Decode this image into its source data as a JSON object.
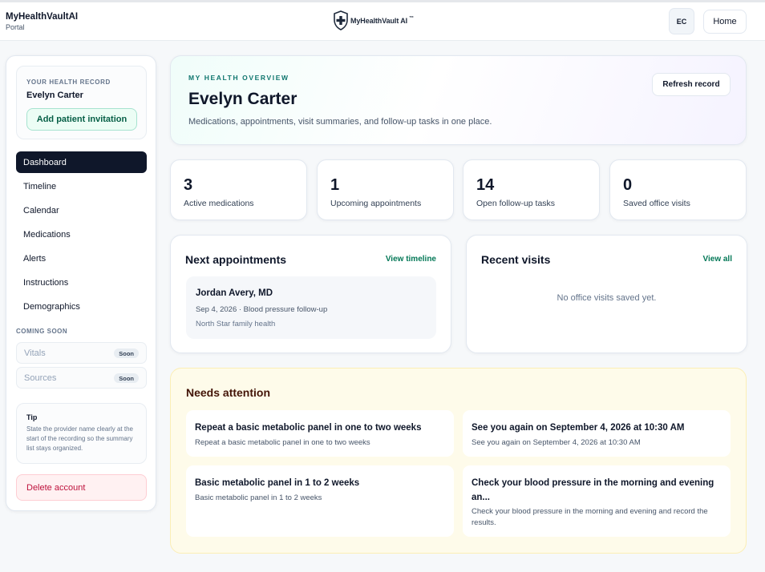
{
  "header": {
    "brand_name": "MyHealthVaultAI",
    "brand_sub": "Portal",
    "logo_text": "MyHealthVault AI",
    "logo_tm": "™",
    "avatar_initials": "EC",
    "home_label": "Home"
  },
  "sidebar": {
    "record_eyebrow": "YOUR HEALTH RECORD",
    "record_name": "Evelyn Carter",
    "invite_label": "Add patient invitation",
    "nav": [
      {
        "label": "Dashboard",
        "active": true
      },
      {
        "label": "Timeline",
        "active": false
      },
      {
        "label": "Calendar",
        "active": false
      },
      {
        "label": "Medications",
        "active": false
      },
      {
        "label": "Alerts",
        "active": false
      },
      {
        "label": "Instructions",
        "active": false
      },
      {
        "label": "Demographics",
        "active": false
      }
    ],
    "coming_soon_label": "COMING SOON",
    "coming_soon": [
      {
        "label": "Vitals",
        "badge": "Soon"
      },
      {
        "label": "Sources",
        "badge": "Soon"
      }
    ],
    "tip_title": "Tip",
    "tip_text": "State the provider name clearly at the start of the recording so the summary list stays organized.",
    "delete_label": "Delete account"
  },
  "hero": {
    "eyebrow": "MY HEALTH OVERVIEW",
    "name": "Evelyn Carter",
    "description": "Medications, appointments, visit summaries, and follow-up tasks in one place.",
    "refresh_label": "Refresh record"
  },
  "stats": [
    {
      "value": "3",
      "label": "Active medications"
    },
    {
      "value": "1",
      "label": "Upcoming appointments"
    },
    {
      "value": "14",
      "label": "Open follow-up tasks"
    },
    {
      "value": "0",
      "label": "Saved office visits"
    }
  ],
  "appointments": {
    "title": "Next appointments",
    "link": "View timeline",
    "items": [
      {
        "provider": "Jordan Avery, MD",
        "date": "Sep 4, 2026 · Blood pressure follow-up",
        "place": "North Star family health"
      }
    ]
  },
  "visits": {
    "title": "Recent visits",
    "link": "View all",
    "empty": "No office visits saved yet."
  },
  "attention": {
    "title": "Needs attention",
    "items": [
      {
        "title": "Repeat a basic metabolic panel in one to two weeks",
        "desc": "Repeat a basic metabolic panel in one to two weeks"
      },
      {
        "title": "See you again on September 4, 2026 at 10:30 AM",
        "desc": "See you again on September 4, 2026 at 10:30 AM"
      },
      {
        "title": "Basic metabolic panel in 1 to 2 weeks",
        "desc": "Basic metabolic panel in 1 to 2 weeks"
      },
      {
        "title": "Check your blood pressure in the morning and evening an...",
        "desc": "Check your blood pressure in the morning and evening and record the results."
      }
    ]
  },
  "colors": {
    "primary_dark": "#0f172a",
    "accent_green": "#047857",
    "danger": "#be123c",
    "attention_bg": "#fefbea"
  }
}
